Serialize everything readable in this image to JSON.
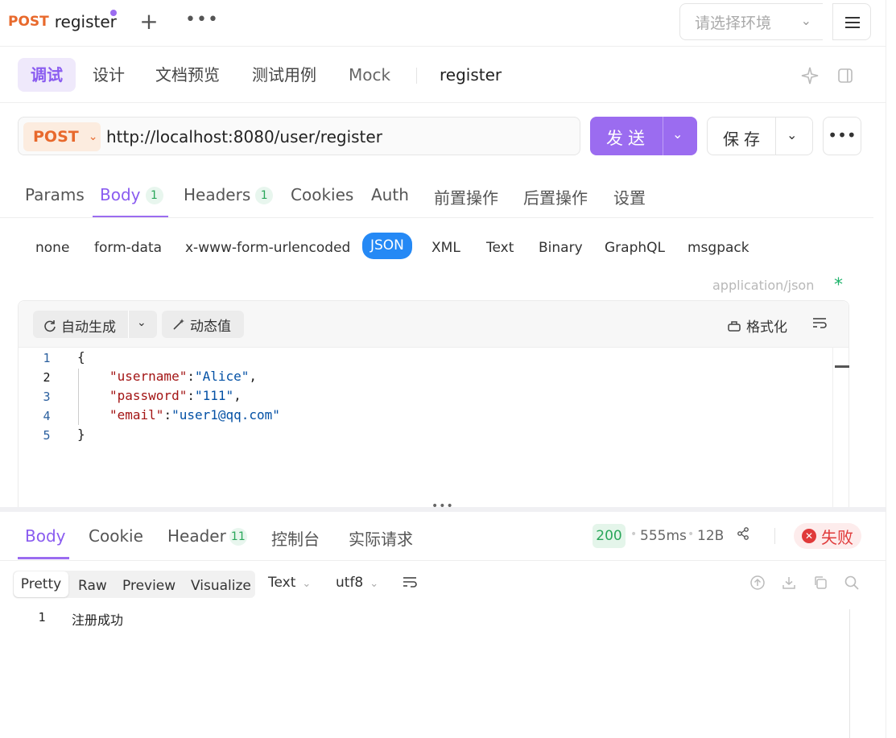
{
  "top": {
    "method": "POST",
    "request_name": "register",
    "plus": "+",
    "more": "•••",
    "env_placeholder": "请选择环境"
  },
  "subtabs": [
    "调试",
    "设计",
    "文档预览",
    "测试用例",
    "Mock",
    "register"
  ],
  "url_bar": {
    "method": "POST",
    "url": "http://localhost:8080/user/register",
    "send_label": "发送",
    "save_label": "保存",
    "more": "•••"
  },
  "request_tabs": [
    {
      "label": "Params"
    },
    {
      "label": "Body",
      "count": "1"
    },
    {
      "label": "Headers",
      "count": "1"
    },
    {
      "label": "Cookies"
    },
    {
      "label": "Auth"
    },
    {
      "label": "前置操作"
    },
    {
      "label": "后置操作"
    },
    {
      "label": "设置"
    }
  ],
  "body_types": [
    "none",
    "form-data",
    "x-www-form-urlencoded",
    "JSON",
    "XML",
    "Text",
    "Binary",
    "GraphQL",
    "msgpack"
  ],
  "content_type": "application/json",
  "required_star": "*",
  "editor": {
    "auto_gen": "自动生成",
    "dynamic_value": "动态值",
    "format": "格式化",
    "lines": [
      {
        "n": "1",
        "text": "{"
      },
      {
        "n": "2",
        "key": "\"username\"",
        "value": "\"Alice\"",
        "tail": ","
      },
      {
        "n": "3",
        "key": "\"password\"",
        "value": "\"111\"",
        "tail": ","
      },
      {
        "n": "4",
        "key": "\"email\"",
        "value": "\"user1@qq.com\"",
        "tail": ""
      },
      {
        "n": "5",
        "text": "}"
      }
    ]
  },
  "response": {
    "tabs": [
      {
        "label": "Body"
      },
      {
        "label": "Cookie"
      },
      {
        "label": "Header",
        "count": "11"
      },
      {
        "label": "控制台"
      },
      {
        "label": "实际请求"
      }
    ],
    "status": "200",
    "time": "555ms",
    "size": "12B",
    "result": "失败",
    "view_modes": [
      "Pretty",
      "Raw",
      "Preview",
      "Visualize"
    ],
    "format": "Text",
    "encoding": "utf8",
    "line_no": "1",
    "content": "注册成功"
  },
  "colors": {
    "accent": "#9b6cf0",
    "method": "#e8692c",
    "json_active": "#2589f5",
    "success": "#2aa65a",
    "error": "#e03a3a"
  }
}
